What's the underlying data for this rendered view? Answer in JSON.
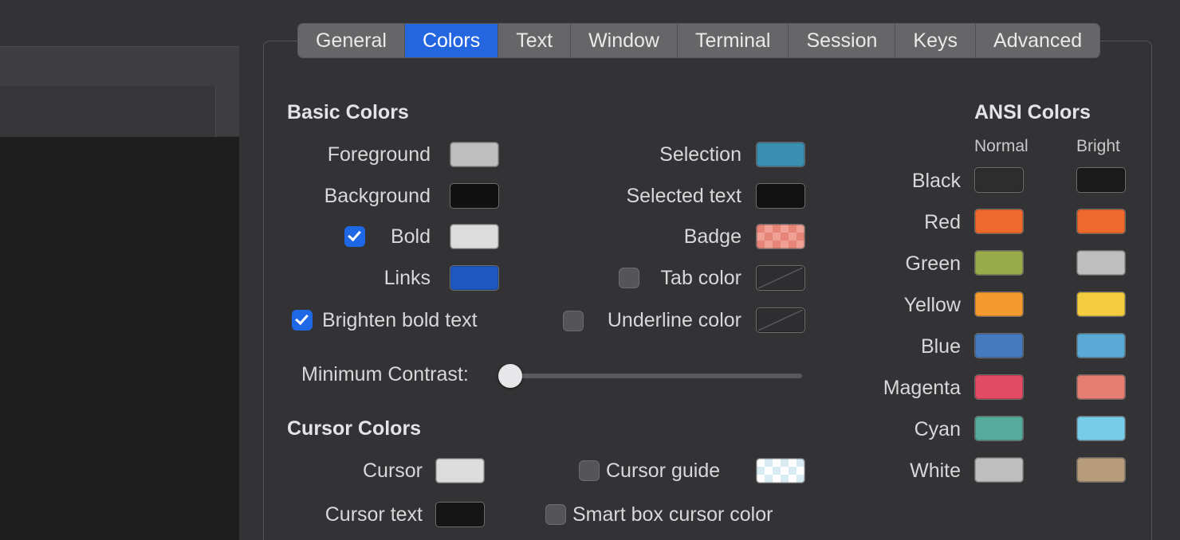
{
  "tabs": [
    "General",
    "Colors",
    "Text",
    "Window",
    "Terminal",
    "Session",
    "Keys",
    "Advanced"
  ],
  "selected_tab_index": 1,
  "sections": {
    "basic_title": "Basic Colors",
    "cursor_title": "Cursor Colors",
    "ansi_title": "ANSI Colors"
  },
  "labels": {
    "foreground": "Foreground",
    "background": "Background",
    "bold": "Bold",
    "links": "Links",
    "brighten": "Brighten bold text",
    "selection": "Selection",
    "selected_text": "Selected text",
    "badge": "Badge",
    "tab_color": "Tab color",
    "underline_color": "Underline color",
    "min_contrast": "Minimum Contrast:",
    "cursor": "Cursor",
    "cursor_text": "Cursor text",
    "cursor_guide": "Cursor guide",
    "smart_box": "Smart box cursor color"
  },
  "colors": {
    "foreground": "#bfbfbf",
    "background": "#111111",
    "bold": "#dcdcdc",
    "links": "#1d57c0",
    "selection": "#3a8fb1",
    "selected_text": "#121212",
    "cursor": "#dcdcdc",
    "cursor_text": "#151515"
  },
  "checkboxes": {
    "bold": true,
    "brighten": true,
    "tab_color": false,
    "underline_color": false,
    "cursor_guide": false,
    "smart_box": false
  },
  "ansi": {
    "col_normal": "Normal",
    "col_bright": "Bright",
    "rows": [
      {
        "name": "Black",
        "normal": "#2d2d2d",
        "bright": "#1a1a1a"
      },
      {
        "name": "Red",
        "normal": "#f0692c",
        "bright": "#f0692c"
      },
      {
        "name": "Green",
        "normal": "#9aab4b",
        "bright": "#bfbfbf"
      },
      {
        "name": "Yellow",
        "normal": "#f49a2e",
        "bright": "#f4cc3f"
      },
      {
        "name": "Blue",
        "normal": "#467abf",
        "bright": "#5aaad6"
      },
      {
        "name": "Magenta",
        "normal": "#e34a63",
        "bright": "#e77e72"
      },
      {
        "name": "Cyan",
        "normal": "#54ab9c",
        "bright": "#77cce9"
      },
      {
        "name": "White",
        "normal": "#bfbfbf",
        "bright": "#b69c7b"
      }
    ]
  }
}
